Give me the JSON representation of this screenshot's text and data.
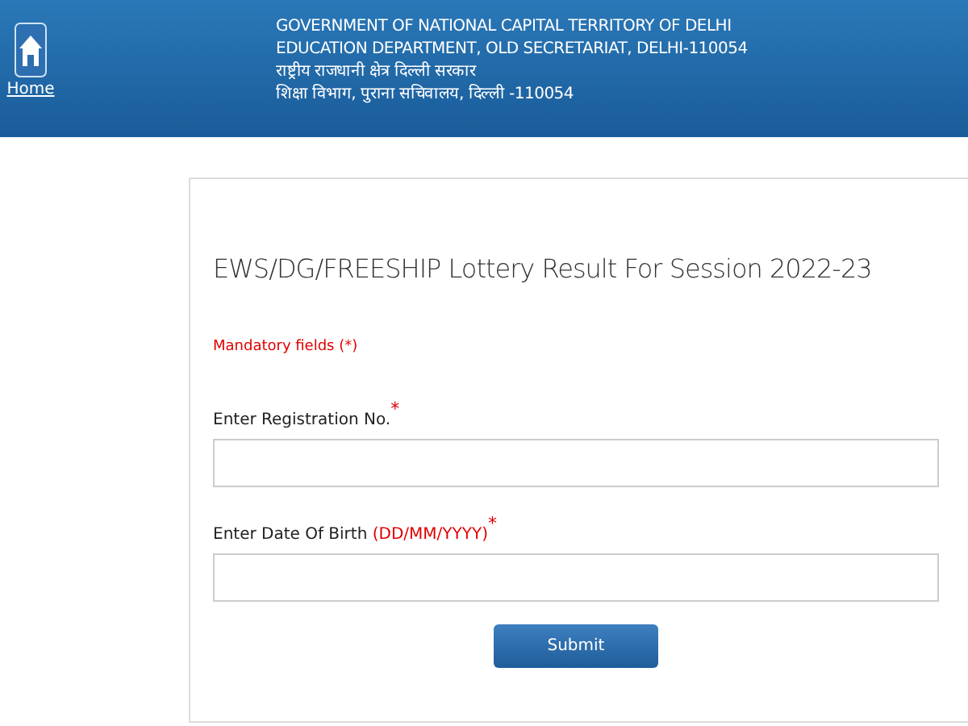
{
  "header": {
    "home_link": "Home",
    "lines": [
      "GOVERNMENT OF NATIONAL CAPITAL TERRITORY OF DELHI",
      "EDUCATION DEPARTMENT, OLD SECRETARIAT, DELHI-110054",
      "राष्ट्रीय राजधानी क्षेत्र दिल्ली सरकार",
      "शिक्षा विभाग, पुराना सचिवालय, दिल्ली -110054"
    ]
  },
  "form": {
    "title": "EWS/DG/FREESHIP Lottery Result For Session 2022-23",
    "note": "Mandatory fields (*)",
    "fields": [
      {
        "label": "Enter Registration No.",
        "required_mark": "*"
      },
      {
        "label": "Enter Date Of Birth",
        "hint": "(DD/MM/YYYY)",
        "required_mark": "*"
      }
    ],
    "submit": "Submit"
  }
}
